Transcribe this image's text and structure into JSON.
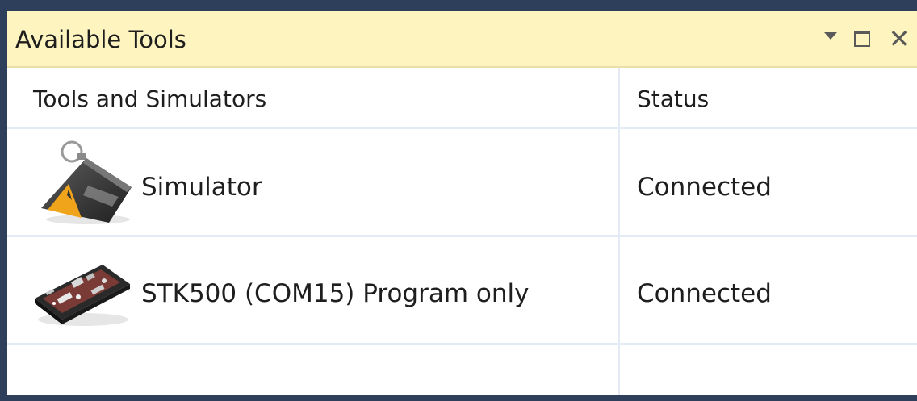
{
  "panel": {
    "title": "Available Tools",
    "controls": {
      "dropdown_icon": "chevron-down-icon",
      "maximize_icon": "maximize-icon",
      "close_glyph": "✕",
      "close_icon": "close-icon"
    }
  },
  "table": {
    "columns": [
      "Tools and Simulators",
      "Status"
    ],
    "rows": [
      {
        "icon": "simulator-icon",
        "name": "Simulator",
        "status": "Connected"
      },
      {
        "icon": "stk500-board-icon",
        "name": "STK500 (COM15) Program only",
        "status": "Connected"
      },
      {
        "icon": "",
        "name": "",
        "status": ""
      }
    ]
  },
  "colors": {
    "titlebar_bg": "#fdf4bf",
    "frame_border": "#2e3f5c",
    "grid_line": "#e5ebf5",
    "text": "#1e1e1e"
  }
}
